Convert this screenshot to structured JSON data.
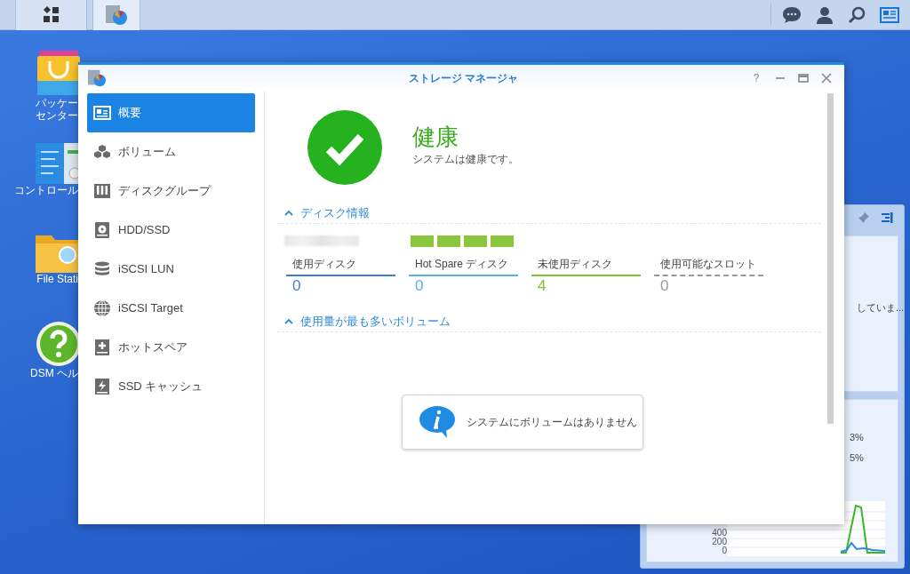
{
  "taskbar": {
    "apps": [
      {
        "kind": "main-menu",
        "selected": false
      },
      {
        "kind": "storage",
        "selected": true
      }
    ]
  },
  "desktop_icons": [
    {
      "kind": "package",
      "lines": [
        "パッケー",
        "センター"
      ]
    },
    {
      "kind": "control",
      "lines": [
        "コントロール"
      ]
    },
    {
      "kind": "folder",
      "lines": [
        "File Stati"
      ]
    },
    {
      "kind": "help",
      "lines": [
        "DSM ヘル"
      ]
    }
  ],
  "widgets": {
    "text_1": "していま...",
    "text_2": "3%",
    "text_3": "5%",
    "y_labels": [
      "400",
      "200",
      "0"
    ]
  },
  "window": {
    "title": "ストレージ マネージャ",
    "controls": [
      "?"
    ]
  },
  "sidebar": {
    "items": [
      {
        "label": "概要",
        "kind": "overview",
        "selected": true
      },
      {
        "label": "ボリューム",
        "kind": "volume",
        "selected": false
      },
      {
        "label": "ディスクグループ",
        "kind": "diskgroup",
        "selected": false
      },
      {
        "label": "HDD/SSD",
        "kind": "hdd",
        "selected": false
      },
      {
        "label": "iSCSI LUN",
        "kind": "lun",
        "selected": false
      },
      {
        "label": "iSCSI Target",
        "kind": "target",
        "selected": false
      },
      {
        "label": "ホットスペア",
        "kind": "hotspare",
        "selected": false
      },
      {
        "label": "SSD キャッシュ",
        "kind": "cache",
        "selected": false
      }
    ]
  },
  "health": {
    "title": "健康",
    "subtitle": "システムは健康です。"
  },
  "disk_info": {
    "header": "ディスク情報",
    "expanded": true,
    "disk_slots": [
      {
        "color": "#8cc63f"
      },
      {
        "color": "#8cc63f"
      },
      {
        "color": "#8cc63f"
      },
      {
        "color": "#8cc63f"
      }
    ],
    "stats": [
      {
        "label": "使用ディスク",
        "value": "0",
        "color": "#3a7fcf",
        "kind": "solid"
      },
      {
        "label": "Hot Spare ディスク",
        "value": "0",
        "color": "#5aaee8",
        "kind": "solid"
      },
      {
        "label": "未使用ディスク",
        "value": "4",
        "color": "#7cc42f",
        "kind": "solid"
      },
      {
        "label": "使用可能なスロット",
        "value": "0",
        "color": "#999999",
        "kind": "dashed"
      }
    ]
  },
  "volumes": {
    "header": "使用量が最も多いボリューム",
    "expanded": true,
    "message": "システムにボリュームはありません"
  }
}
